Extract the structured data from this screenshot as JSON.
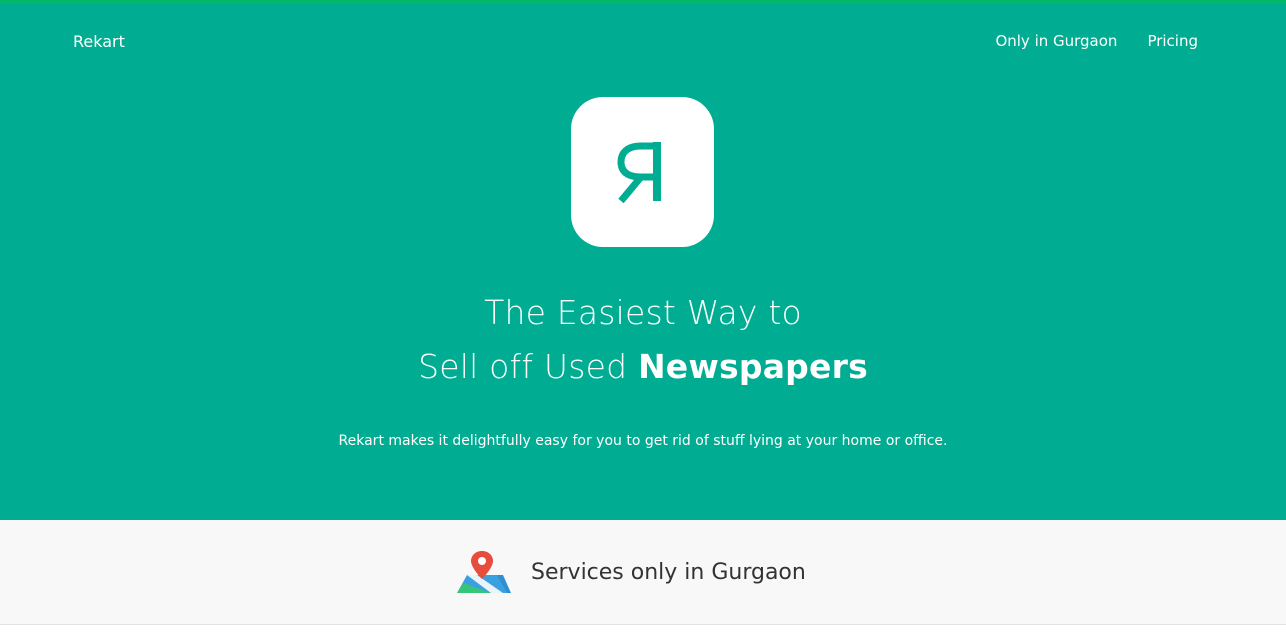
{
  "brand": {
    "name": "Rekart",
    "logo_glyph": "Я"
  },
  "nav": {
    "items": [
      {
        "label": "Only in Gurgaon"
      },
      {
        "label": "Pricing"
      }
    ]
  },
  "hero": {
    "headline_line1": "The Easiest Way to",
    "headline_line2_prefix": "Sell off Used",
    "headline_line2_emphasis": "Newspapers",
    "tagline": "Rekart makes it delightfully easy for you to get rid of stuff lying at your home or office."
  },
  "service": {
    "text": "Services only in Gurgaon",
    "icon": "map-pin-icon"
  },
  "colors": {
    "primary": "#01ad92",
    "accent_top": "#02b86b",
    "strip_bg": "#f8f8f8",
    "pin": "#e84c3d"
  }
}
